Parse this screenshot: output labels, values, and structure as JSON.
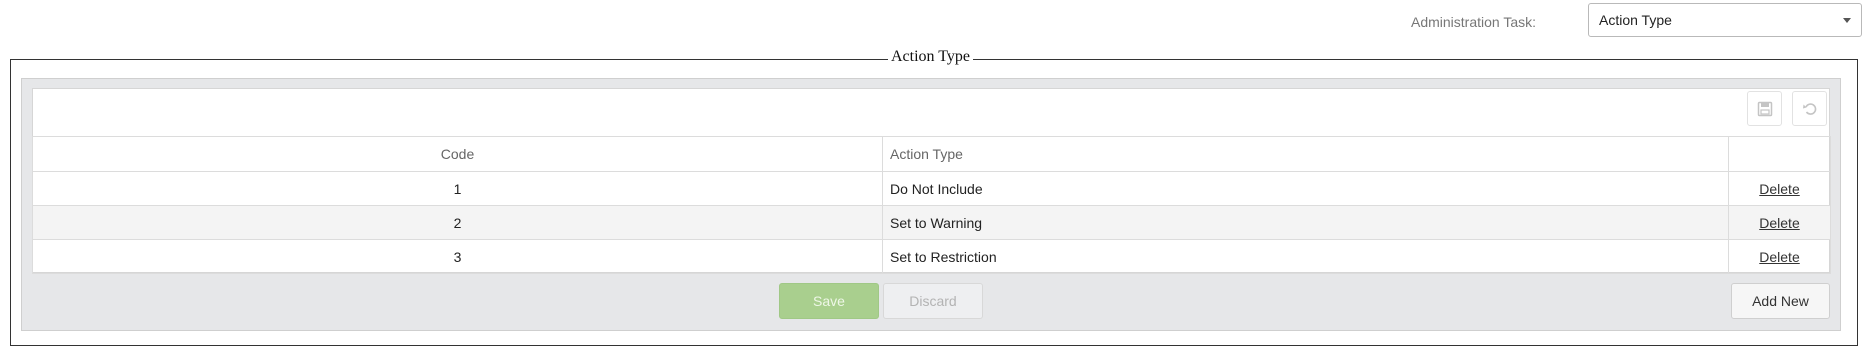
{
  "header": {
    "admin_task_label": "Administration Task:",
    "admin_task_value": "Action Type"
  },
  "section": {
    "legend": "Action Type"
  },
  "grid": {
    "columns": [
      "Code",
      "Action Type",
      ""
    ],
    "rows": [
      {
        "code": "1",
        "action_type": "Do Not Include",
        "delete": "Delete"
      },
      {
        "code": "2",
        "action_type": "Set to Warning",
        "delete": "Delete"
      },
      {
        "code": "3",
        "action_type": "Set to Restriction",
        "delete": "Delete"
      }
    ]
  },
  "toolbar": {
    "save_icon": "save-icon",
    "undo_icon": "undo-icon"
  },
  "buttons": {
    "save": "Save",
    "discard": "Discard",
    "add_new": "Add New"
  }
}
